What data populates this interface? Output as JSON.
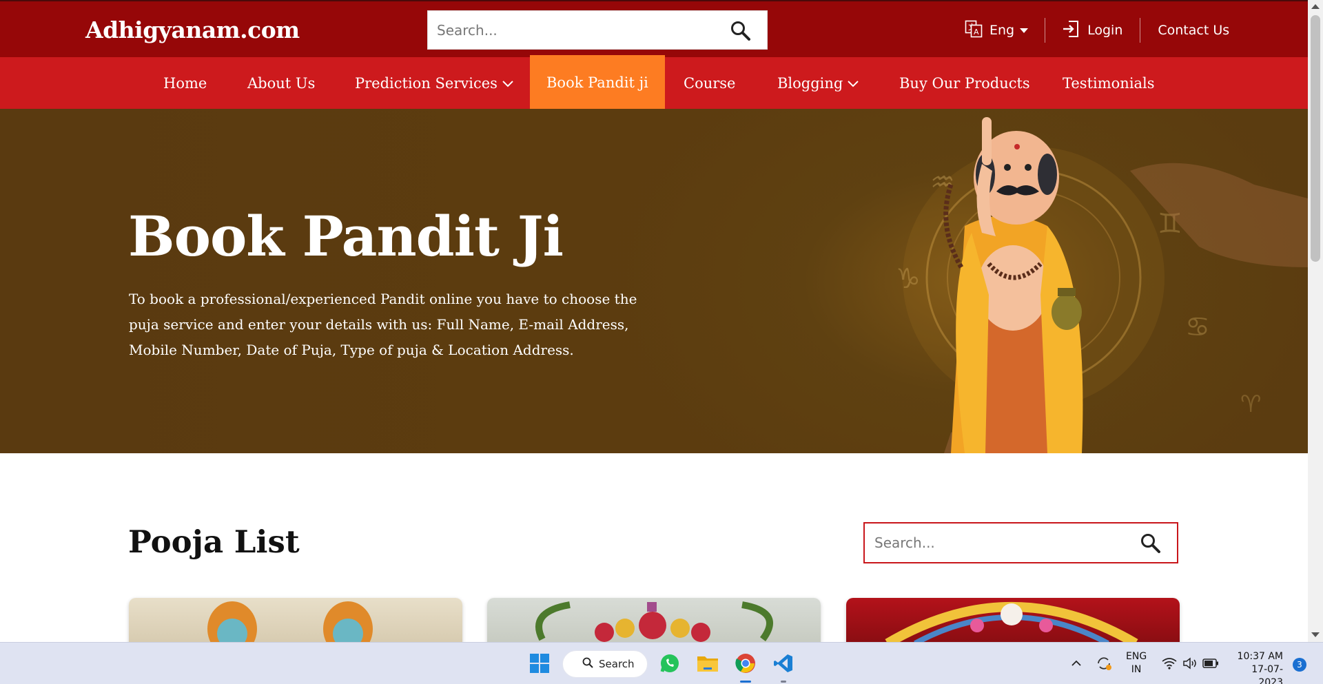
{
  "header": {
    "logo": "Adhigyanam.com",
    "search_placeholder": "Search...",
    "language_label": "Eng",
    "login_label": "Login",
    "contact_label": "Contact Us"
  },
  "nav": {
    "items": [
      {
        "label": "Home"
      },
      {
        "label": "About Us"
      },
      {
        "label": "Prediction Services"
      },
      {
        "label": "Book Pandit ji"
      },
      {
        "label": "Course"
      },
      {
        "label": "Blogging"
      },
      {
        "label": "Buy Our Products"
      },
      {
        "label": "Testimonials"
      }
    ],
    "active_item": "Book Pandit ji"
  },
  "hero": {
    "title": "Book Pandit Ji",
    "description": "To book a professional/experienced Pandit online you have to choose the puja service and enter your details with us: Full Name, E-mail Address, Mobile Number, Date of Puja, Type of puja & Location Address."
  },
  "pooja_list": {
    "title": "Pooja List",
    "search_placeholder": "Search..."
  },
  "taskbar": {
    "search_label": "Search",
    "lang_line1": "ENG",
    "lang_line2": "IN",
    "time": "10:37 AM",
    "date": "17-07-2023",
    "notification_count": "3"
  },
  "colors": {
    "topbar": "#960708",
    "navbar": "#cd1a1d",
    "nav_active": "#fd7c22",
    "hero_bg": "#5a3a10",
    "accent_border": "#c8151a"
  }
}
